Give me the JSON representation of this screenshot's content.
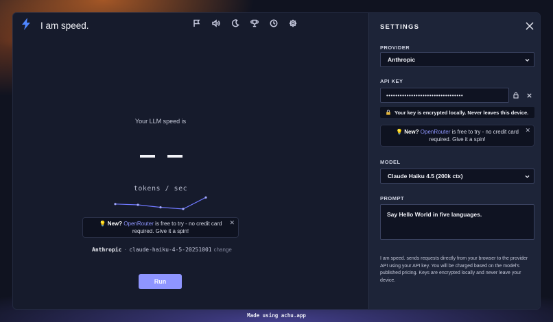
{
  "brand": {
    "title": "I am speed.",
    "icon": "lightning-icon",
    "accent": "#5b8cff"
  },
  "toolbar": {
    "items": [
      {
        "name": "flag-icon"
      },
      {
        "name": "volume-icon"
      },
      {
        "name": "moon-icon"
      },
      {
        "name": "trophy-icon"
      },
      {
        "name": "history-icon"
      },
      {
        "name": "gear-icon"
      }
    ]
  },
  "main": {
    "speed_label": "Your LLM speed is",
    "speed_value": "— —",
    "unit": "tokens / sec",
    "provider": "Anthropic",
    "separator": "·",
    "model_id": "claude-haiku-4-5-20251001",
    "change_label": "change",
    "run_label": "Run"
  },
  "chart_data": {
    "type": "line",
    "x": [
      1,
      2,
      3,
      4,
      5
    ],
    "values": [
      0.55,
      0.5,
      0.35,
      0.25,
      0.95
    ],
    "title": "",
    "xlabel": "",
    "ylabel": ""
  },
  "promo": {
    "bulb": "💡",
    "bold": "New?",
    "link": "OpenRouter",
    "text": "is free to try - no credit card required. Give it a spin!",
    "close": "✕"
  },
  "settings": {
    "title": "SETTINGS",
    "provider_label": "PROVIDER",
    "provider_value": "Anthropic",
    "api_key_label": "API KEY",
    "api_key_value": "••••••••••••••••••••••••••••••••••",
    "encrypted_note": "Your key is encrypted locally. Never leaves this device.",
    "model_label": "MODEL",
    "model_value": "Claude Haiku 4.5 (200k ctx)",
    "prompt_label": "PROMPT",
    "prompt_value": "Say Hello World in five languages.",
    "disclaimer": "I am speed. sends requests directly from your browser to the provider API using your API key. You will be charged based on the model's published pricing. Keys are encrypted locally and never leave your device."
  },
  "footer": {
    "text": "Made using achu.app"
  }
}
